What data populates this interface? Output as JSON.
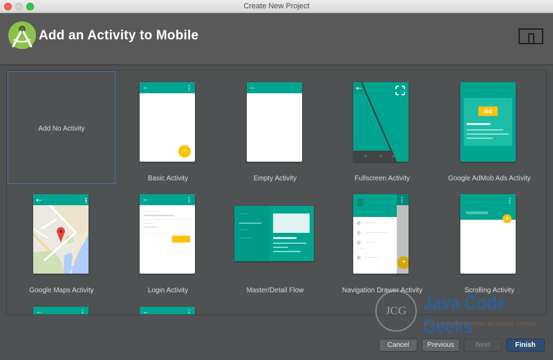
{
  "window": {
    "title": "Create New Project"
  },
  "header": {
    "title": "Add an Activity to Mobile",
    "logo_icon": "android-studio-logo",
    "device_icon": "phone-tablet-icon"
  },
  "colors": {
    "accent_teal": "#00a490",
    "fab_yellow": "#ffc107",
    "selection_border": "#4b6ea8",
    "finish_button": "#2f4d72"
  },
  "activities": [
    {
      "label": "Add No Activity",
      "selected": true
    },
    {
      "label": "Basic Activity"
    },
    {
      "label": "Empty Activity"
    },
    {
      "label": "Fullscreen Activity"
    },
    {
      "label": "Google AdMob Ads Activity",
      "ad_badge": "Ad"
    },
    {
      "label": "Google Maps Activity"
    },
    {
      "label": "Login Activity"
    },
    {
      "label": "Master/Detail Flow"
    },
    {
      "label": "Navigation Drawer Activity"
    },
    {
      "label": "Scrolling Activity"
    }
  ],
  "watermark": {
    "brand": "Java Code Geeks",
    "monogram": "JCG",
    "tagline": "Java 2 Java Developers Resource Center"
  },
  "footer": {
    "cancel_label": "Cancel",
    "previous_label": "Previous",
    "next_label": "Next",
    "finish_label": "Finish"
  }
}
